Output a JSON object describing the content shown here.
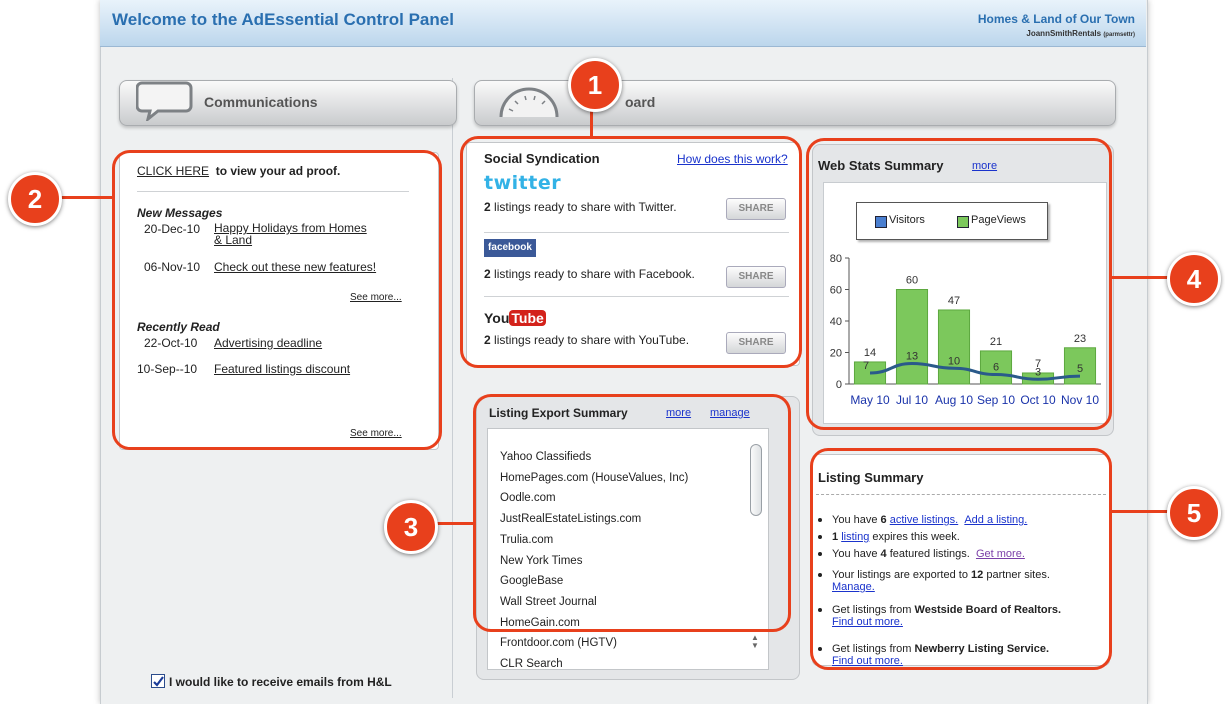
{
  "header": {
    "title": "Welcome to the AdEssential Control Panel",
    "site_name": "Homes & Land of Our Town",
    "account": "JoannSmithRentals",
    "account_suffix": "(parmsettr)"
  },
  "communications": {
    "header_label": "Communications",
    "ad_proof_link": "CLICK HERE",
    "ad_proof_text": "to view your ad proof.",
    "new_messages_title": "New Messages",
    "new_messages": [
      {
        "date": "20-Dec-10",
        "subject_line1": "Happy Holidays from Homes",
        "subject_line2": "& Land"
      },
      {
        "date": "06-Nov-10",
        "subject_line1": "Check out these new features!"
      }
    ],
    "see_more_1": "See more...",
    "recently_read_title": "Recently Read",
    "recently_read": [
      {
        "date": "22-Oct-10",
        "subject": "Advertising deadline"
      },
      {
        "date": "10-Sep--10",
        "subject": "Featured listings discount"
      }
    ],
    "see_more_2": "See more...",
    "email_opt_in_label": "I would like to receive emails from H&L",
    "email_opt_in_checked": true
  },
  "dashboard": {
    "header_label": "Dashboard",
    "header_label_visible": "oard"
  },
  "social": {
    "title": "Social Syndication",
    "how_link": "How does this work?",
    "twitter_logo": "twitter",
    "twitter_count": "2",
    "twitter_text": "listings ready to share with Twitter.",
    "facebook_logo": "facebook",
    "facebook_count": "2",
    "facebook_text": "listings ready to share with Facebook.",
    "youtube_logo_you": "You",
    "youtube_logo_tube": "Tube",
    "youtube_count": "2",
    "youtube_text": "listings ready to share with YouTube.",
    "share_label": "SHARE"
  },
  "web_stats": {
    "title": "Web Stats Summary",
    "more_link": "more"
  },
  "chart_data": {
    "type": "bar",
    "categories": [
      "May 10",
      "Jul 10",
      "Aug 10",
      "Sep 10",
      "Oct 10",
      "Nov 10"
    ],
    "series": [
      {
        "name": "Visitors",
        "type": "line",
        "values": [
          7,
          13,
          10,
          6,
          3,
          5
        ],
        "color": "#2a5a8a"
      },
      {
        "name": "PageViews",
        "type": "bar",
        "values": [
          14,
          60,
          47,
          21,
          7,
          23
        ],
        "color": "#7cc85c"
      }
    ],
    "ylim": [
      0,
      80
    ],
    "yticks": [
      0,
      20,
      40,
      60,
      80
    ],
    "legend": "top",
    "grid": false
  },
  "listing_export": {
    "title": "Listing Export Summary",
    "more_link": "more",
    "manage_link": "manage",
    "sites": [
      "Yahoo Classifieds",
      "HomePages.com (HouseValues, Inc)",
      "Oodle.com",
      "JustRealEstateListings.com",
      "Trulia.com",
      "New York Times",
      "GoogleBase",
      "Wall Street Journal",
      "HomeGain.com",
      "Frontdoor.com (HGTV)",
      "CLR Search"
    ]
  },
  "listing_summary": {
    "title": "Listing Summary",
    "item1_pre": "You have",
    "item1_count": "6",
    "item1_link": "active listings.",
    "item1_link2": "Add a listing.",
    "item2_count": "1",
    "item2_link": "listing",
    "item2_post": "expires this week.",
    "item3_pre": "You have",
    "item3_count": "4",
    "item3_post": "featured listings.",
    "item3_link": "Get more.",
    "item4_pre": "Your listings are exported to",
    "item4_count": "12",
    "item4_post": "partner sites.",
    "item4_link": "Manage.",
    "item5_pre": "Get listings from",
    "item5_org": "Westside Board of Realtors.",
    "item5_link": "Find out more.",
    "item6_pre": "Get listings from",
    "item6_org": "Newberry Listing Service.",
    "item6_link": "Find out more."
  },
  "callouts": [
    "1",
    "2",
    "3",
    "4",
    "5"
  ],
  "colors": {
    "callout": "#e8401c",
    "link": "#1a33cc",
    "title": "#2a6fb0"
  }
}
